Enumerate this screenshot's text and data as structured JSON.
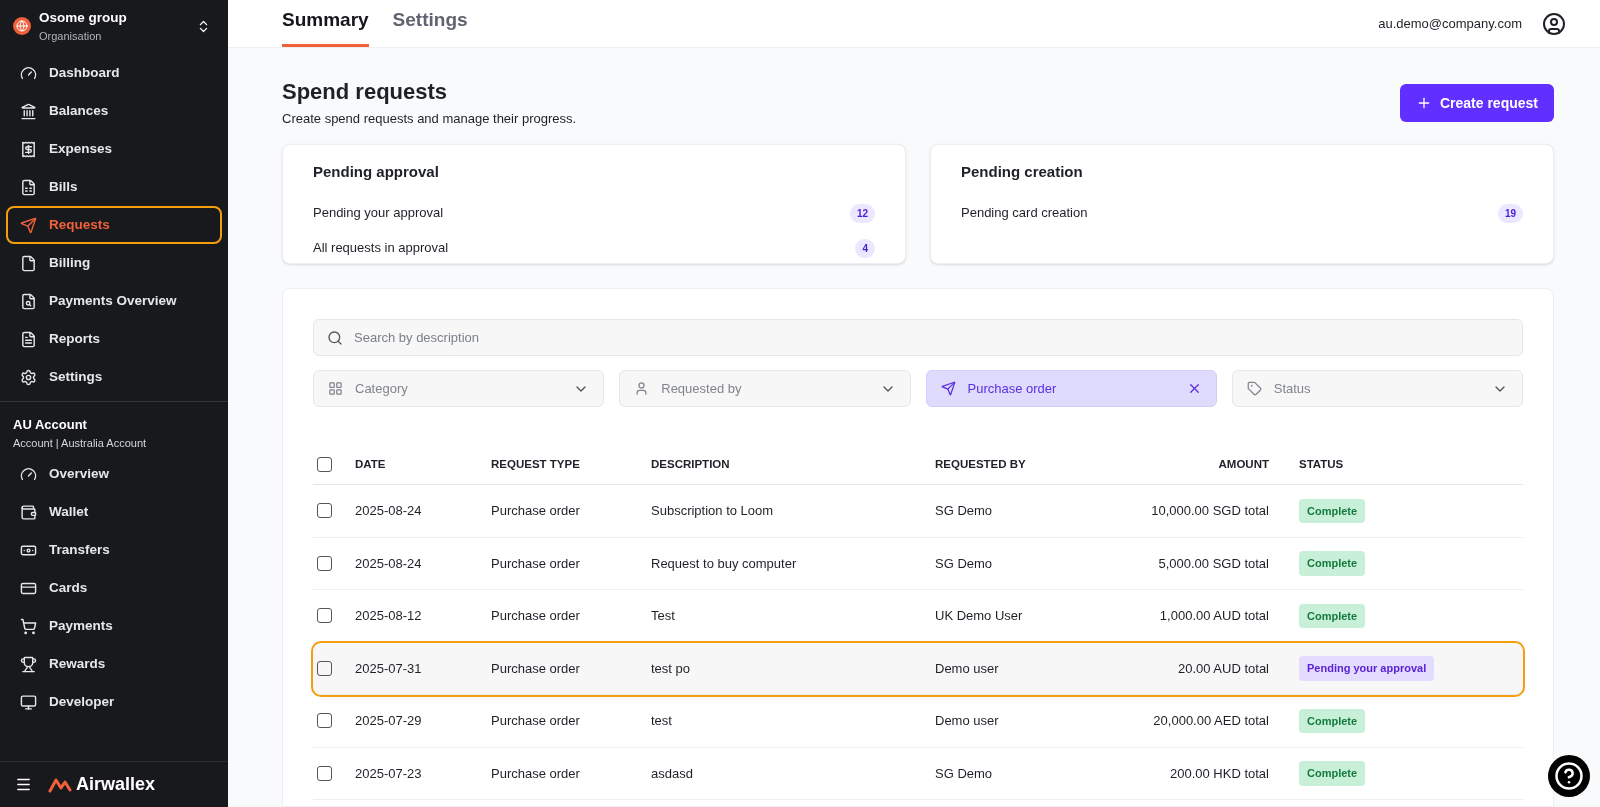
{
  "sidebar": {
    "org": {
      "name": "Osome group",
      "subtitle": "Organisation"
    },
    "items": [
      {
        "label": "Dashboard",
        "selected": false
      },
      {
        "label": "Balances",
        "selected": false
      },
      {
        "label": "Expenses",
        "selected": false
      },
      {
        "label": "Bills",
        "selected": false
      },
      {
        "label": "Requests",
        "selected": true
      },
      {
        "label": "Billing",
        "selected": false
      },
      {
        "label": "Payments Overview",
        "selected": false
      },
      {
        "label": "Reports",
        "selected": false
      },
      {
        "label": "Settings",
        "selected": false
      }
    ],
    "account": {
      "name": "AU Account",
      "subtitle": "Account | Australia Account"
    },
    "account_items": [
      {
        "label": "Overview",
        "selected": false
      },
      {
        "label": "Wallet",
        "selected": false
      },
      {
        "label": "Transfers",
        "selected": false
      },
      {
        "label": "Cards",
        "selected": false
      },
      {
        "label": "Payments",
        "selected": false
      },
      {
        "label": "Rewards",
        "selected": false
      },
      {
        "label": "Developer",
        "selected": false
      }
    ],
    "logo": "Airwallex"
  },
  "tabs": [
    {
      "label": "Summary",
      "selected": true
    },
    {
      "label": "Settings",
      "selected": false
    }
  ],
  "user_email": "au.demo@company.com",
  "page": {
    "title": "Spend requests",
    "subtitle": "Create spend requests and manage their progress.",
    "create_button": "Create request"
  },
  "summary_cards": [
    {
      "title": "Pending approval",
      "rows": [
        {
          "label": "Pending your approval",
          "count": "12"
        },
        {
          "label": "All requests in approval",
          "count": "4"
        }
      ]
    },
    {
      "title": "Pending creation",
      "rows": [
        {
          "label": "Pending card creation",
          "count": "19"
        }
      ]
    }
  ],
  "search": {
    "placeholder": "Search by description"
  },
  "filters": [
    {
      "label": "Category",
      "selected": false
    },
    {
      "label": "Requested by",
      "selected": false
    },
    {
      "label": "Purchase order",
      "selected": true
    },
    {
      "label": "Status",
      "selected": false
    }
  ],
  "table": {
    "select_all_checked": false,
    "columns": [
      "DATE",
      "REQUEST TYPE",
      "DESCRIPTION",
      "REQUESTED BY",
      "AMOUNT",
      "STATUS"
    ],
    "rows": [
      {
        "checked": false,
        "highlighted": false,
        "cells": [
          "2025-08-24",
          "Purchase order",
          "Subscription to Loom",
          "SG Demo",
          "10,000.00 SGD total"
        ],
        "status": {
          "label": "Complete",
          "kind": "complete"
        }
      },
      {
        "checked": false,
        "highlighted": false,
        "cells": [
          "2025-08-24",
          "Purchase order",
          "Request to buy computer",
          "SG Demo",
          "5,000.00 SGD total"
        ],
        "status": {
          "label": "Complete",
          "kind": "complete"
        }
      },
      {
        "checked": false,
        "highlighted": false,
        "cells": [
          "2025-08-12",
          "Purchase order",
          "Test",
          "UK Demo User",
          "1,000.00 AUD total"
        ],
        "status": {
          "label": "Complete",
          "kind": "complete"
        }
      },
      {
        "checked": false,
        "highlighted": true,
        "cells": [
          "2025-07-31",
          "Purchase order",
          "test po",
          "Demo user",
          "20.00 AUD total"
        ],
        "status": {
          "label": "Pending your approval",
          "kind": "pending"
        }
      },
      {
        "checked": false,
        "highlighted": false,
        "cells": [
          "2025-07-29",
          "Purchase order",
          "test",
          "Demo user",
          "20,000.00 AED total"
        ],
        "status": {
          "label": "Complete",
          "kind": "complete"
        }
      },
      {
        "checked": false,
        "highlighted": false,
        "cells": [
          "2025-07-23",
          "Purchase order",
          "asdasd",
          "SG Demo",
          "200.00 HKD total"
        ],
        "status": {
          "label": "Complete",
          "kind": "complete"
        }
      }
    ]
  }
}
